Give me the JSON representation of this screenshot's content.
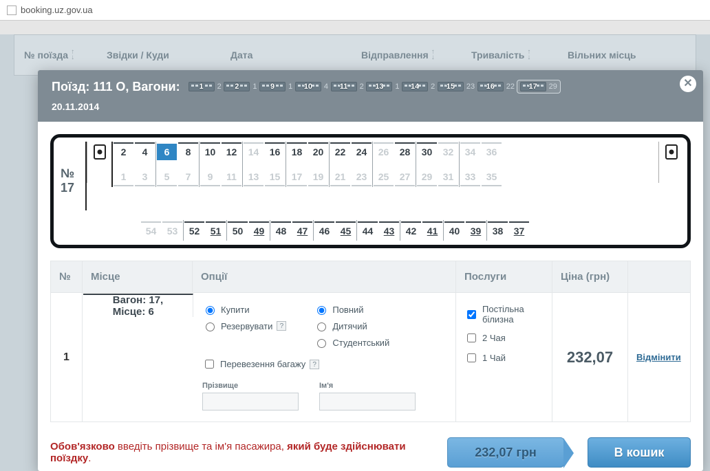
{
  "url": "booking.uz.gov.ua",
  "table_headers": {
    "train_no": "№ поїзда",
    "from_to": "Звідки / Куди",
    "date": "Дата",
    "departure": "Відправлення",
    "duration": "Тривалість",
    "free": "Вільних місць"
  },
  "modal": {
    "title": "Поїзд: 111 О, Вагони:",
    "date": "20.11.2014",
    "wagons": [
      {
        "num": "1",
        "free": "2"
      },
      {
        "num": "2",
        "free": "1"
      },
      {
        "num": "9",
        "free": "1"
      },
      {
        "num": "10",
        "free": "4"
      },
      {
        "num": "11",
        "free": "2"
      },
      {
        "num": "13",
        "free": "1"
      },
      {
        "num": "14",
        "free": "2"
      },
      {
        "num": "15",
        "free": "23"
      },
      {
        "num": "16",
        "free": "22"
      },
      {
        "num": "17",
        "free": "29",
        "selected": true
      }
    ],
    "coach_label_top": "№",
    "coach_label_num": "17",
    "bays_top": [
      [
        [
          "2",
          1
        ],
        [
          "4",
          1
        ]
      ],
      [
        [
          "6",
          2
        ],
        [
          "8",
          1
        ]
      ],
      [
        [
          "10",
          1
        ],
        [
          "12",
          1
        ]
      ],
      [
        [
          "14",
          0
        ],
        [
          "16",
          1
        ]
      ],
      [
        [
          "18",
          1
        ],
        [
          "20",
          1
        ]
      ],
      [
        [
          "22",
          1
        ],
        [
          "24",
          1
        ]
      ],
      [
        [
          "26",
          0
        ],
        [
          "28",
          1
        ]
      ],
      [
        [
          "30",
          1
        ],
        [
          "32",
          0
        ]
      ],
      [
        [
          "34",
          0
        ],
        [
          "36",
          0
        ]
      ]
    ],
    "bays_bottom": [
      [
        [
          "1",
          0
        ],
        [
          "3",
          0
        ]
      ],
      [
        [
          "5",
          0
        ],
        [
          "7",
          0
        ]
      ],
      [
        [
          "9",
          0
        ],
        [
          "11",
          0
        ]
      ],
      [
        [
          "13",
          0
        ],
        [
          "15",
          0
        ]
      ],
      [
        [
          "17",
          0
        ],
        [
          "19",
          0
        ]
      ],
      [
        [
          "21",
          0
        ],
        [
          "23",
          0
        ]
      ],
      [
        [
          "25",
          0
        ],
        [
          "27",
          0
        ]
      ],
      [
        [
          "29",
          0
        ],
        [
          "31",
          0
        ]
      ],
      [
        [
          "33",
          0
        ],
        [
          "35",
          0
        ]
      ]
    ],
    "side_bays": [
      [
        [
          "54",
          0
        ],
        [
          "53",
          0
        ]
      ],
      [
        [
          "52",
          1
        ],
        [
          "51",
          1
        ]
      ],
      [
        [
          "50",
          1
        ],
        [
          "49",
          1
        ]
      ],
      [
        [
          "48",
          1
        ],
        [
          "47",
          1
        ]
      ],
      [
        [
          "46",
          1
        ],
        [
          "45",
          1
        ]
      ],
      [
        [
          "44",
          1
        ],
        [
          "43",
          1
        ]
      ],
      [
        [
          "42",
          1
        ],
        [
          "41",
          1
        ]
      ],
      [
        [
          "40",
          1
        ],
        [
          "39",
          1
        ]
      ],
      [
        [
          "38",
          1
        ],
        [
          "37",
          1
        ]
      ]
    ],
    "ptable_head": {
      "n": "№",
      "seat": "Місце",
      "opt": "Опції",
      "serv": "Послуги",
      "price": "Ціна (грн)"
    },
    "passenger": {
      "index": "1",
      "seat_line1": "Вагон: 17,",
      "seat_line2": "Місце: 6",
      "buy": "Купити",
      "reserve": "Резервувати",
      "full": "Повний",
      "child": "Дитячий",
      "student": "Студентський",
      "baggage": "Перевезення багажу",
      "lastname_label": "Прізвище",
      "firstname_label": "Ім'я",
      "lastname_value": "",
      "firstname_value": "",
      "bed": "Постільна білизна",
      "tea2": "2 Чая",
      "tea1": "1 Чай",
      "price": "232,07",
      "cancel": "Відмінити"
    },
    "footer": {
      "warn_pre": "Обов'язково ",
      "warn_mid": "введіть прізвище та ім'я пасажира, ",
      "warn_bold2": "який буде здійснювати поїздку",
      "total": "232,07 грн",
      "cart": "В кошик"
    }
  }
}
